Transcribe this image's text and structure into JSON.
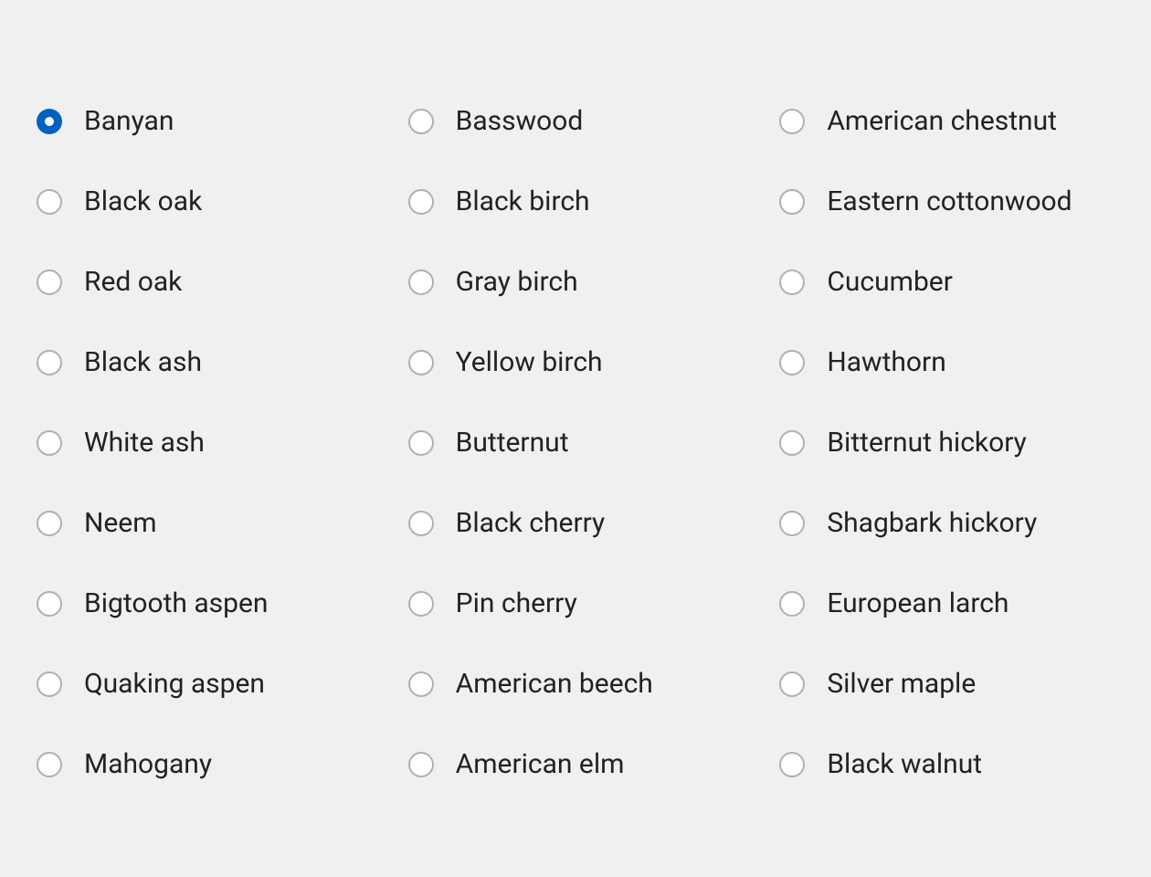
{
  "radio_group": {
    "selected_index": 0,
    "options": [
      {
        "label": "Banyan"
      },
      {
        "label": "Black oak"
      },
      {
        "label": "Red oak"
      },
      {
        "label": "Black ash"
      },
      {
        "label": "White ash"
      },
      {
        "label": "Neem"
      },
      {
        "label": "Bigtooth aspen"
      },
      {
        "label": "Quaking aspen"
      },
      {
        "label": "Mahogany"
      },
      {
        "label": "Basswood"
      },
      {
        "label": "Black birch"
      },
      {
        "label": "Gray birch"
      },
      {
        "label": "Yellow birch"
      },
      {
        "label": "Butternut"
      },
      {
        "label": "Black cherry"
      },
      {
        "label": "Pin cherry"
      },
      {
        "label": "American beech"
      },
      {
        "label": "American elm"
      },
      {
        "label": "American chestnut"
      },
      {
        "label": "Eastern cottonwood"
      },
      {
        "label": "Cucumber"
      },
      {
        "label": "Hawthorn"
      },
      {
        "label": "Bitternut hickory"
      },
      {
        "label": "Shagbark hickory"
      },
      {
        "label": "European larch"
      },
      {
        "label": "Silver maple"
      },
      {
        "label": "Black walnut"
      }
    ]
  }
}
